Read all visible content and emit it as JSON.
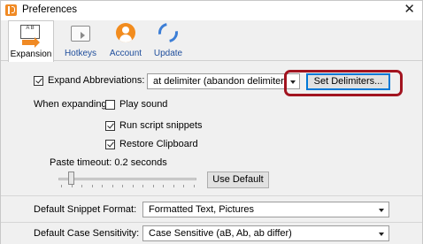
{
  "window": {
    "title": "Preferences"
  },
  "toolbar": {
    "tabs": [
      {
        "label": "Expansion",
        "icon": "expansion-icon",
        "active": true
      },
      {
        "label": "Hotkeys",
        "icon": "hotkeys-icon"
      },
      {
        "label": "Account",
        "icon": "account-icon"
      },
      {
        "label": "Update",
        "icon": "update-icon"
      }
    ],
    "expansion_icon_text": "A B"
  },
  "expansion": {
    "expand_abbreviations_label": "Expand Abbreviations:",
    "expand_abbreviations_checked": true,
    "expand_mode_value": "at delimiter (abandon delimiter)",
    "set_delimiters_label": "Set Delimiters...",
    "when_expanding_label": "When expanding:",
    "play_sound_label": "Play sound",
    "play_sound_checked": false,
    "run_script_label": "Run script snippets",
    "run_script_checked": true,
    "restore_clipboard_label": "Restore Clipboard",
    "restore_clipboard_checked": true,
    "paste_timeout_label": "Paste timeout: 0.2 seconds",
    "paste_timeout_seconds": 0.2,
    "use_default_label": "Use Default",
    "default_snippet_format_label": "Default Snippet Format:",
    "default_snippet_format_value": "Formatted Text, Pictures",
    "default_case_sensitivity_label": "Default Case Sensitivity:",
    "default_case_sensitivity_value": "Case Sensitive (aB, Ab, ab differ)"
  },
  "colors": {
    "highlight": "#a21420",
    "accent": "#f28c1e",
    "link": "#1f4e9c"
  }
}
